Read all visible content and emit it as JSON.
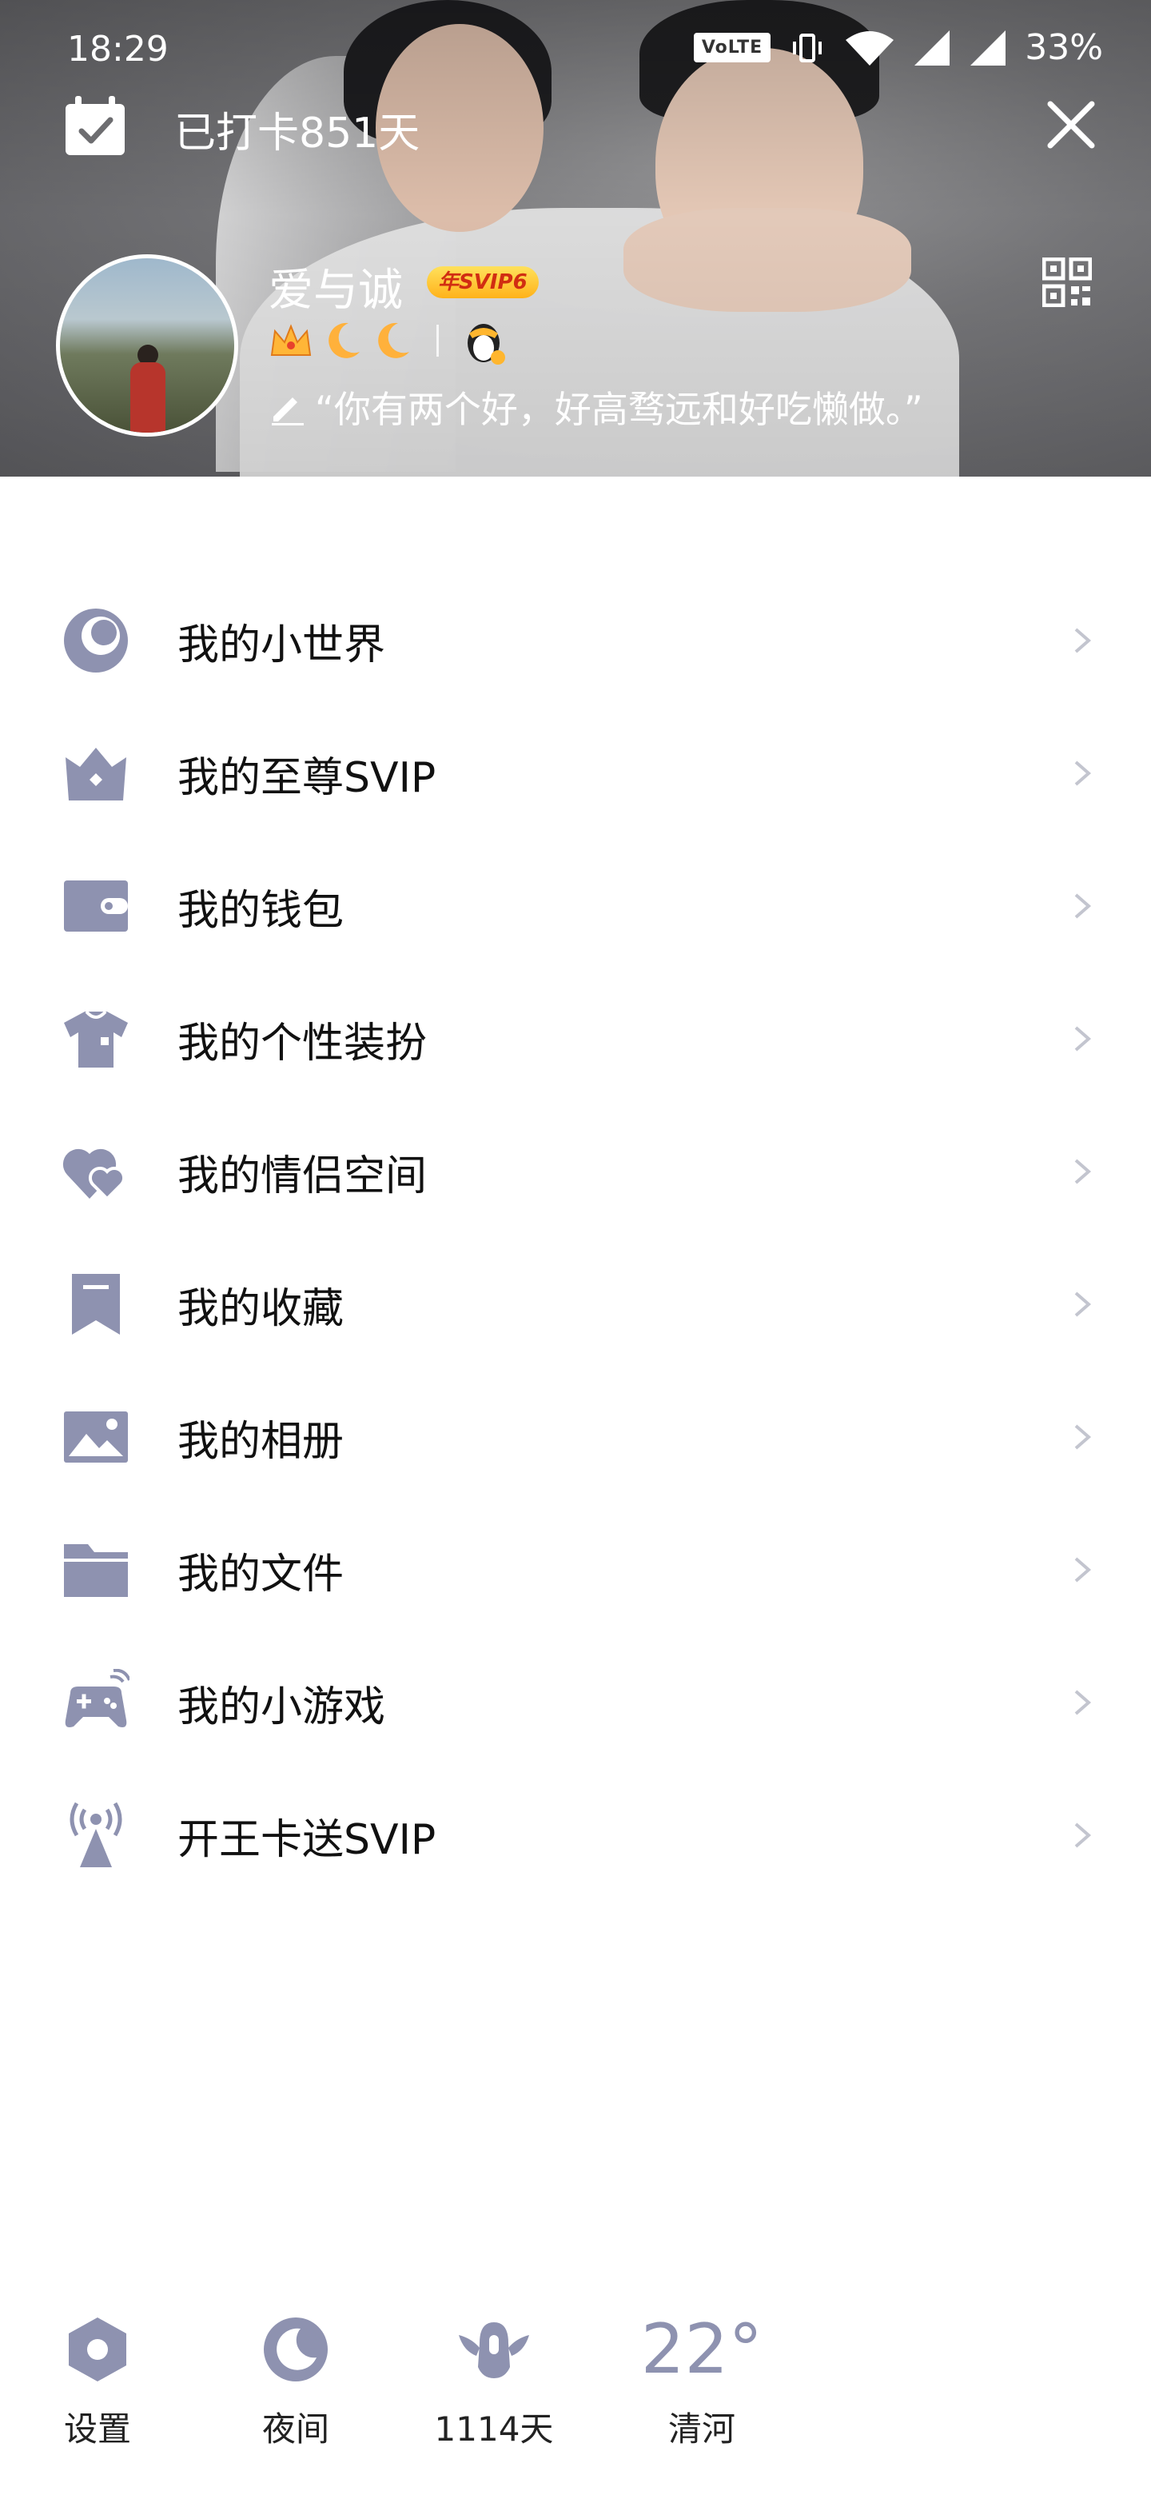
{
  "status_bar": {
    "time": "18:29",
    "volte": "VoLTE",
    "battery": "33%"
  },
  "header": {
    "checkin_text": "已打卡851天",
    "username": "爱与诚",
    "svip_badge": "年SVIP6",
    "signature": "“你有两个好，好高骛远和好吃懒做。”"
  },
  "menu": {
    "items": [
      {
        "label": "我的小世界",
        "icon": "small-world-icon"
      },
      {
        "label": "我的至尊SVIP",
        "icon": "crown-icon"
      },
      {
        "label": "我的钱包",
        "icon": "wallet-icon"
      },
      {
        "label": "我的个性装扮",
        "icon": "shirt-icon"
      },
      {
        "label": "我的情侣空间",
        "icon": "hearts-icon"
      },
      {
        "label": "我的收藏",
        "icon": "bookmark-icon"
      },
      {
        "label": "我的相册",
        "icon": "photo-icon"
      },
      {
        "label": "我的文件",
        "icon": "folder-icon"
      },
      {
        "label": "我的小游戏",
        "icon": "gamepad-icon"
      },
      {
        "label": "开王卡送SVIP",
        "icon": "signal-tower-icon"
      }
    ]
  },
  "bottom_bar": {
    "settings_label": "设置",
    "night_label": "夜间",
    "days_label": "1114天",
    "weather_temp": "22°",
    "weather_city": "清河"
  },
  "colors": {
    "icon": "#8e92b0",
    "chevron": "#c3c5cf",
    "text": "#111111"
  }
}
